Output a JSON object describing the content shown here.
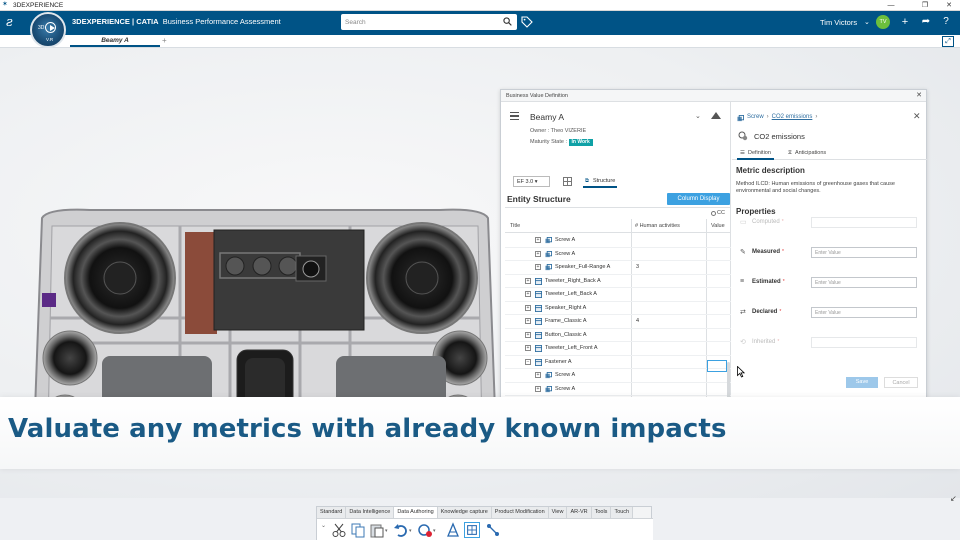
{
  "window": {
    "title": "3DEXPERIENCE"
  },
  "topbar": {
    "brand_bold": "3DEXPERIENCE | CATIA",
    "brand_app": "Business Performance Assessment",
    "compass_3d": "3D",
    "compass_version": "V.R",
    "search_placeholder": "Search",
    "user_name": "Tim Victors",
    "avatar_initials": "TV"
  },
  "tabs": [
    {
      "label": "Beamy A"
    }
  ],
  "bvd": {
    "title": "Business Value Definition",
    "item": {
      "name": "Beamy A",
      "owner_label": "Owner : Theo VIZERIE",
      "maturity_label": "Maturity State :",
      "maturity_value": "In Work"
    },
    "ef_version": "EF 3.0",
    "structure_tab": "Structure",
    "entity_title": "Entity Structure",
    "column_display_label": "Column Display",
    "columns": {
      "title": "Title",
      "activities": "# Human activities",
      "co": "CC",
      "value": "Value"
    },
    "rows": [
      {
        "label": "Screw  A",
        "level": 2,
        "activities": ""
      },
      {
        "label": "Screw  A",
        "level": 2,
        "activities": ""
      },
      {
        "label": "Speaker_Full-Range  A",
        "level": 2,
        "activities": "3"
      },
      {
        "label": "Tweeter_Right_Back  A",
        "level": 1,
        "activities": ""
      },
      {
        "label": "Tweeter_Left_Back  A",
        "level": 1,
        "activities": ""
      },
      {
        "label": "Speaker_Right  A",
        "level": 1,
        "activities": ""
      },
      {
        "label": "Frame_Classic  A",
        "level": 1,
        "activities": "4"
      },
      {
        "label": "Button_Classic  A",
        "level": 1,
        "activities": ""
      },
      {
        "label": "Tweeter_Left_Front  A",
        "level": 1,
        "activities": ""
      },
      {
        "label": "Fastener  A",
        "level": 1,
        "activities": "",
        "expanded": true
      },
      {
        "label": "Screw  A",
        "level": 2,
        "activities": ""
      },
      {
        "label": "Screw  A",
        "level": 2,
        "activities": ""
      },
      {
        "label": "Screw  A",
        "level": 2,
        "activities": ""
      }
    ],
    "metric": {
      "crumb_root": "Screw",
      "crumb_current": "CO2 emissions",
      "name": "CO2 emissions",
      "tabs": [
        "Definition",
        "Anticipations"
      ],
      "description_title": "Metric description",
      "method_text": "Method ILCD: Human emissions of greenhouse gases that cause environmental and social changes.",
      "properties_title": "Properties",
      "properties": [
        {
          "label": "Computed",
          "placeholder": "",
          "disabled": true
        },
        {
          "label": "Measured",
          "placeholder": "Enter Value",
          "disabled": false
        },
        {
          "label": "Estimated",
          "placeholder": "Enter Value",
          "disabled": false
        },
        {
          "label": "Declared",
          "placeholder": "Enter Value",
          "disabled": false
        },
        {
          "label": "Inherited",
          "placeholder": "",
          "disabled": true
        }
      ],
      "save_label": "Save",
      "cancel_label": "Cancel"
    }
  },
  "caption": "Valuate any metrics with already known impacts",
  "actionbar": {
    "tabs": [
      "Standard",
      "Data Intelligence",
      "Data Authoring",
      "Knowledge capture",
      "Product Modification",
      "View",
      "AR-VR",
      "Tools",
      "Touch"
    ],
    "active_tab": "Data Authoring"
  },
  "colors": {
    "brand": "#005386",
    "accent": "#3ca1e1",
    "in_work": "#0fa1a6",
    "caption": "#1a5a85"
  }
}
